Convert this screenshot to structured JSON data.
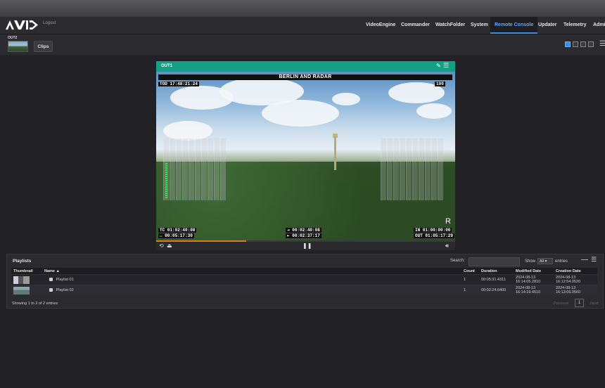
{
  "nav": {
    "logo": "AVID",
    "logout": "Logout",
    "items": [
      {
        "label": "VideoEngine"
      },
      {
        "label": "Commander"
      },
      {
        "label": "WatchFolder"
      },
      {
        "label": "System"
      },
      {
        "label": "Remote Console",
        "active": true
      },
      {
        "label": "Updater"
      },
      {
        "label": "Telemetry"
      },
      {
        "label": "Admin"
      }
    ]
  },
  "subbar": {
    "output_label": "OUT2",
    "clips_button": "Clips"
  },
  "player": {
    "header": "OUT1",
    "title": "BERLIN AND RADAR",
    "tod": "TOD 17:48:21:24",
    "level": "100",
    "tc": "TC 01:02:40:08",
    "remaining": "↔ 00:05:17:30",
    "in_point_mid": "⇥ 00:02:40:08",
    "out_point_mid": "⇤ 00:02:37:17",
    "in": "IN  01:00:00:00",
    "out": "OUT 01:05:17:29",
    "r_mark": "R",
    "progress": 0.3
  },
  "playlists": {
    "title": "Playlists",
    "search_label": "Search:",
    "search_value": "",
    "show_label": "Show",
    "show_value": "All",
    "entries_label": "entries",
    "columns": [
      "Thumbnail",
      "Name ▲",
      "Count",
      "Duration",
      "Modified Date",
      "Creation Date"
    ],
    "rows": [
      {
        "name": "Playlist 01",
        "count": "1",
        "duration": "00:05:31.4311",
        "modified": "2024-08-13 16:14:05.2810",
        "created": "2024-08-13 16:12:54.0520"
      },
      {
        "name": "Playlist 02",
        "count": "1",
        "duration": "00:02:24.6400",
        "modified": "2024-08-13 16:14:19.4510",
        "created": "2024-08-13 16:13:09.0560"
      }
    ],
    "info": "Showing 1 to 2 of 2 entries",
    "previous": "Previous",
    "page": "1",
    "next": "Next"
  },
  "colors": {
    "accent": "#3b8fe0",
    "player_header": "#14a085",
    "progress": "#e07a1f"
  }
}
